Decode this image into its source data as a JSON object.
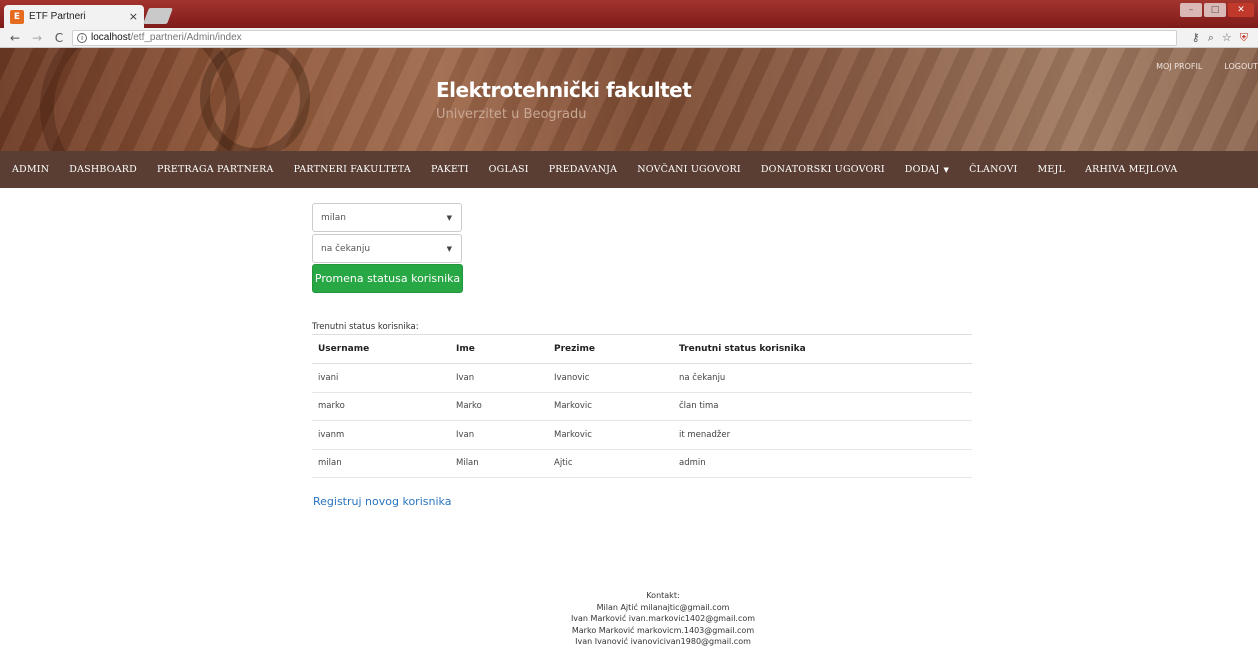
{
  "browser": {
    "tab_title": "ETF Partneri",
    "tab_close": "×",
    "url_host": "localhost",
    "url_path": "/etf_partneri/Admin/index"
  },
  "header": {
    "title": "Elektrotehnički fakultet",
    "subtitle": "Univerzitet u Beogradu",
    "links": [
      "MOJ PROFIL",
      "LOGOUT"
    ]
  },
  "nav": {
    "items": [
      "ADMIN",
      "DASHBOARD",
      "PRETRAGA PARTNERA",
      "PARTNERI FAKULTETA",
      "PAKETI",
      "OGLASI",
      "PREDAVANJA",
      "NOVČANI UGOVORI",
      "DONATORSKI UGOVORI",
      "DODAJ",
      "ČLANOVI",
      "MEJL",
      "ARHIVA MEJLOVA"
    ]
  },
  "form": {
    "user_select": "milan",
    "status_select": "na čekanju",
    "submit_label": "Promena statusa korisnika"
  },
  "table": {
    "caption": "Trenutni status korisnika:",
    "headers": [
      "Username",
      "Ime",
      "Prezime",
      "Trenutni status korisnika"
    ],
    "rows": [
      [
        "ivani",
        "Ivan",
        "Ivanovic",
        "na čekanju"
      ],
      [
        "marko",
        "Marko",
        "Markovic",
        "član tima"
      ],
      [
        "ivanm",
        "Ivan",
        "Markovic",
        "it menadžer"
      ],
      [
        "milan",
        "Milan",
        "Ajtic",
        "admin"
      ]
    ]
  },
  "register_link": "Registruj novog korisnika",
  "footer": {
    "label": "Kontakt:",
    "contacts": [
      "Milan Ajtić milanajtic@gmail.com",
      "Ivan Marković ivan.markovic1402@gmail.com",
      "Marko Marković markovicm.1403@gmail.com",
      "Ivan Ivanović ivanovicivan1980@gmail.com"
    ]
  },
  "colors": {
    "primary_button": "#28a745",
    "link": "#2a74c0",
    "navbar": "#5a3e33"
  }
}
